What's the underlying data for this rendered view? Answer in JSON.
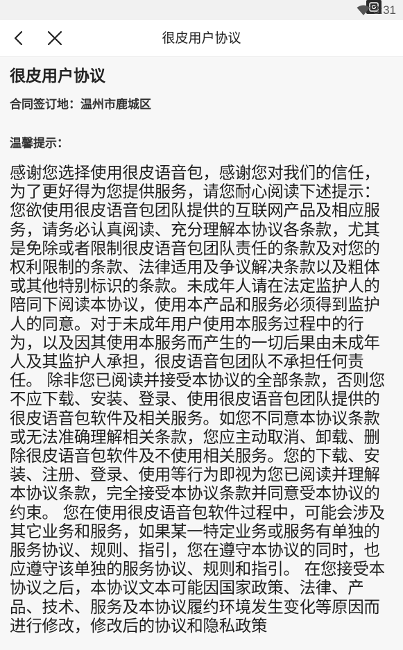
{
  "status_bar": {
    "time": "3:31",
    "icons": [
      "wifi-icon",
      "screenshot-icon"
    ]
  },
  "nav": {
    "title": "很皮用户协议",
    "back_icon": "chevron-left-icon",
    "close_icon": "close-icon"
  },
  "document": {
    "title": "很皮用户协议",
    "place": "合同签订地：温州市鹿城区",
    "tip": "温馨提示：",
    "body": "感谢您选择使用很皮语音包，感谢您对我们的信任，为了更好得为您提供服务，请您耐心阅读下述提示： 您欲使用很皮语音包团队提供的互联网产品及相应服务，请务必认真阅读、充分理解本协议各条款，尤其是免除或者限制很皮语音包团队责任的条款及对您的权利限制的条款、法律适用及争议解决条款以及粗体或其他特别标识的条款。未成年人请在法定监护人的陪同下阅读本协议，使用本产品和服务必须得到监护人的同意。对于未成年用户使用本服务过程中的行为，以及因其使用本服务而产生的一切后果由未成年人及其监护人承担，很皮语音包团队不承担任何责任。 除非您已阅读并接受本协议的全部条款，否则您不应下载、安装、登录、使用很皮语音包团队提供的很皮语音包软件及相关服务。如您不同意本协议条款或无法准确理解相关条款，您应主动取消、卸载、删除很皮语音包软件及不使用相关服务。您的下载、安装、注册、登录、使用等行为即视为您已阅读并理解本协议条款，完全接受本协议条款并同意受本协议的约束。 您在使用很皮语音包软件过程中，可能会涉及其它业务和服务，如果某一特定业务或服务有单独的服务协议、规则、指引，您在遵守本协议的同时，也应遵守该单独的服务协议、规则和指引。 在您接受本协议之后，本协议文本可能因国家政策、法律、产品、技术、服务及本协议履约环境发生变化等原因而进行修改，修改后的协议和隐私政策"
  }
}
